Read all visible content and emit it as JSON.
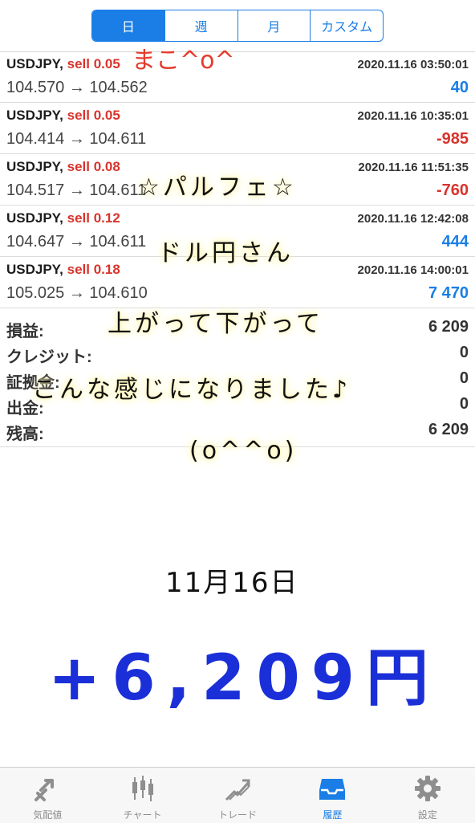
{
  "period_tabs": [
    "日",
    "週",
    "月",
    "カスタム"
  ],
  "trades": [
    {
      "symbol": "USDJPY,",
      "side": "sell 0.05",
      "time": "2020.11.16 03:50:01",
      "prices": "104.570 → 104.562",
      "profit": "40",
      "profit_sign": "pos"
    },
    {
      "symbol": "USDJPY,",
      "side": "sell 0.05",
      "time": "2020.11.16 10:35:01",
      "prices": "104.414 → 104.611",
      "profit": "-985",
      "profit_sign": "neg"
    },
    {
      "symbol": "USDJPY,",
      "side": "sell 0.08",
      "time": "2020.11.16 11:51:35",
      "prices": "104.517 → 104.611",
      "profit": "-760",
      "profit_sign": "neg"
    },
    {
      "symbol": "USDJPY,",
      "side": "sell 0.12",
      "time": "2020.11.16 12:42:08",
      "prices": "104.647 → 104.611",
      "profit": "444",
      "profit_sign": "pos"
    },
    {
      "symbol": "USDJPY,",
      "side": "sell 0.18",
      "time": "2020.11.16 14:00:01",
      "prices": "105.025 → 104.610",
      "profit": "7 470",
      "profit_sign": "pos"
    }
  ],
  "summary": [
    {
      "label": "損益:",
      "value": "6 209"
    },
    {
      "label": "クレジット:",
      "value": "0"
    },
    {
      "label": "証拠金:",
      "value": "0"
    },
    {
      "label": "出金:",
      "value": "0"
    },
    {
      "label": "残高:",
      "value": "6 209"
    }
  ],
  "handwriting": {
    "signature": "まこ^o^",
    "line1": "☆パルフェ☆",
    "line2": "ドル円さん",
    "line3": "上がって下がって",
    "line4": "こんな感じになりました♪",
    "line5": "(o^^o)",
    "date": "11月16日",
    "amount": "+6,209円"
  },
  "tabbar": [
    {
      "label": "気配値",
      "icon": "quotes-icon"
    },
    {
      "label": "チャート",
      "icon": "chart-icon"
    },
    {
      "label": "トレード",
      "icon": "trade-icon"
    },
    {
      "label": "履歴",
      "icon": "history-icon",
      "active": true
    },
    {
      "label": "設定",
      "icon": "settings-icon"
    }
  ],
  "colors": {
    "accent": "#1a7ee6",
    "negative": "#d9332b",
    "amount_ink": "#1b2fd8"
  }
}
